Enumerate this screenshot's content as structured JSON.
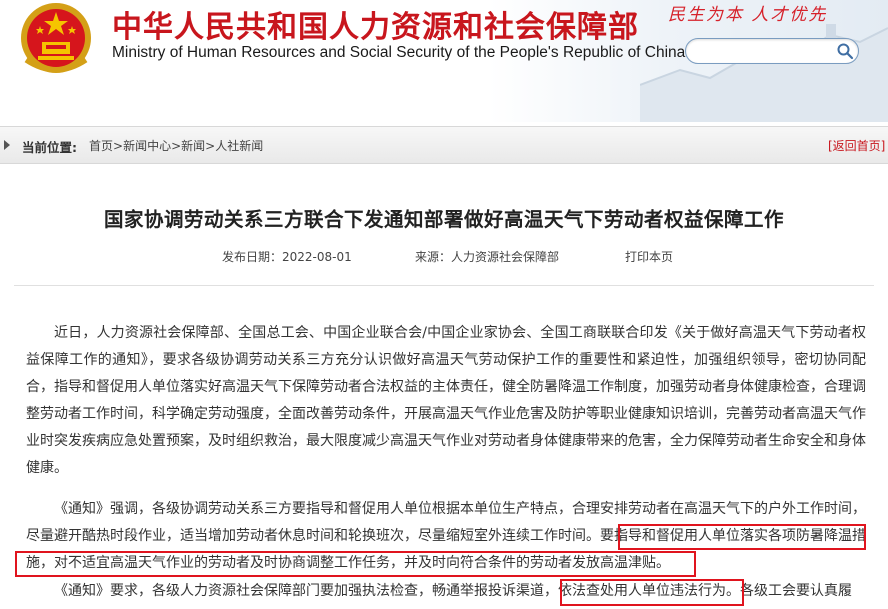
{
  "header": {
    "title_cn": "中华人民共和国人力资源和社会保障部",
    "title_en": "Ministry of Human Resources and Social Security of the People's Republic of China",
    "slogan": "民生为本 人才优先",
    "search": {
      "placeholder": ""
    }
  },
  "breadcrumb": {
    "label": "当前位置:",
    "items": [
      "首页",
      "新闻中心",
      "新闻",
      "人社新闻"
    ],
    "separator": ">",
    "back": "[返回首页]"
  },
  "article": {
    "title": "国家协调劳动关系三方联合下发通知部署做好高温天气下劳动者权益保障工作",
    "date": "发布日期：2022-08-01",
    "source": "来源：人力资源社会保障部",
    "print": "打印本页",
    "p1": "近日，人力资源社会保障部、全国总工会、中国企业联合会/中国企业家协会、全国工商联联合印发《关于做好高温天气下劳动者权益保障工作的通知》，要求各级协调劳动关系三方充分认识做好高温天气劳动保护工作的重要性和紧迫性，加强组织领导，密切协同配合，指导和督促用人单位落实好高温天气下保障劳动者合法权益的主体责任，健全防暑降温工作制度，加强劳动者身体健康检查，合理调整劳动者工作时间，科学确定劳动强度，全面改善劳动条件，开展高温天气作业危害及防护等职业健康知识培训，完善劳动者高温天气作业时突发疾病应急处置预案，及时组织救治，最大限度减少高温天气作业对劳动者身体健康带来的危害，全力保障劳动者生命安全和身体健康。",
    "p2_a": "《通知》强调，各级协调劳动关系三方要指导和督促用人单位根据本单位生产特点，合理安排劳动者在高温天气下的户外工作时间，尽量避开酷热时段作业，适当增加劳动者休息时间和轮换班次，尽量缩短室外连续工作时间。",
    "p2_b": "要指导和督促用人单位落实各项防暑降温措施，对不适宜高温天气作业的劳动者及时协商调整工作任务，并及时向符合条件的劳动者发放高温津贴。",
    "p3_a": "《通知》要求，各级人力资源社会保障部门要加强执法检查，畅通举报投诉渠道，",
    "p3_b": "依法查处用人单位违法行为。",
    "p3_c": "各级工会要认真履"
  },
  "colors": {
    "brand_red": "#c8161d",
    "highlight_red": "#e0141e"
  },
  "icons": {
    "search": "search-icon",
    "emblem": "national-emblem-icon",
    "breadcrumb_arrow": "triangle-right-icon"
  }
}
